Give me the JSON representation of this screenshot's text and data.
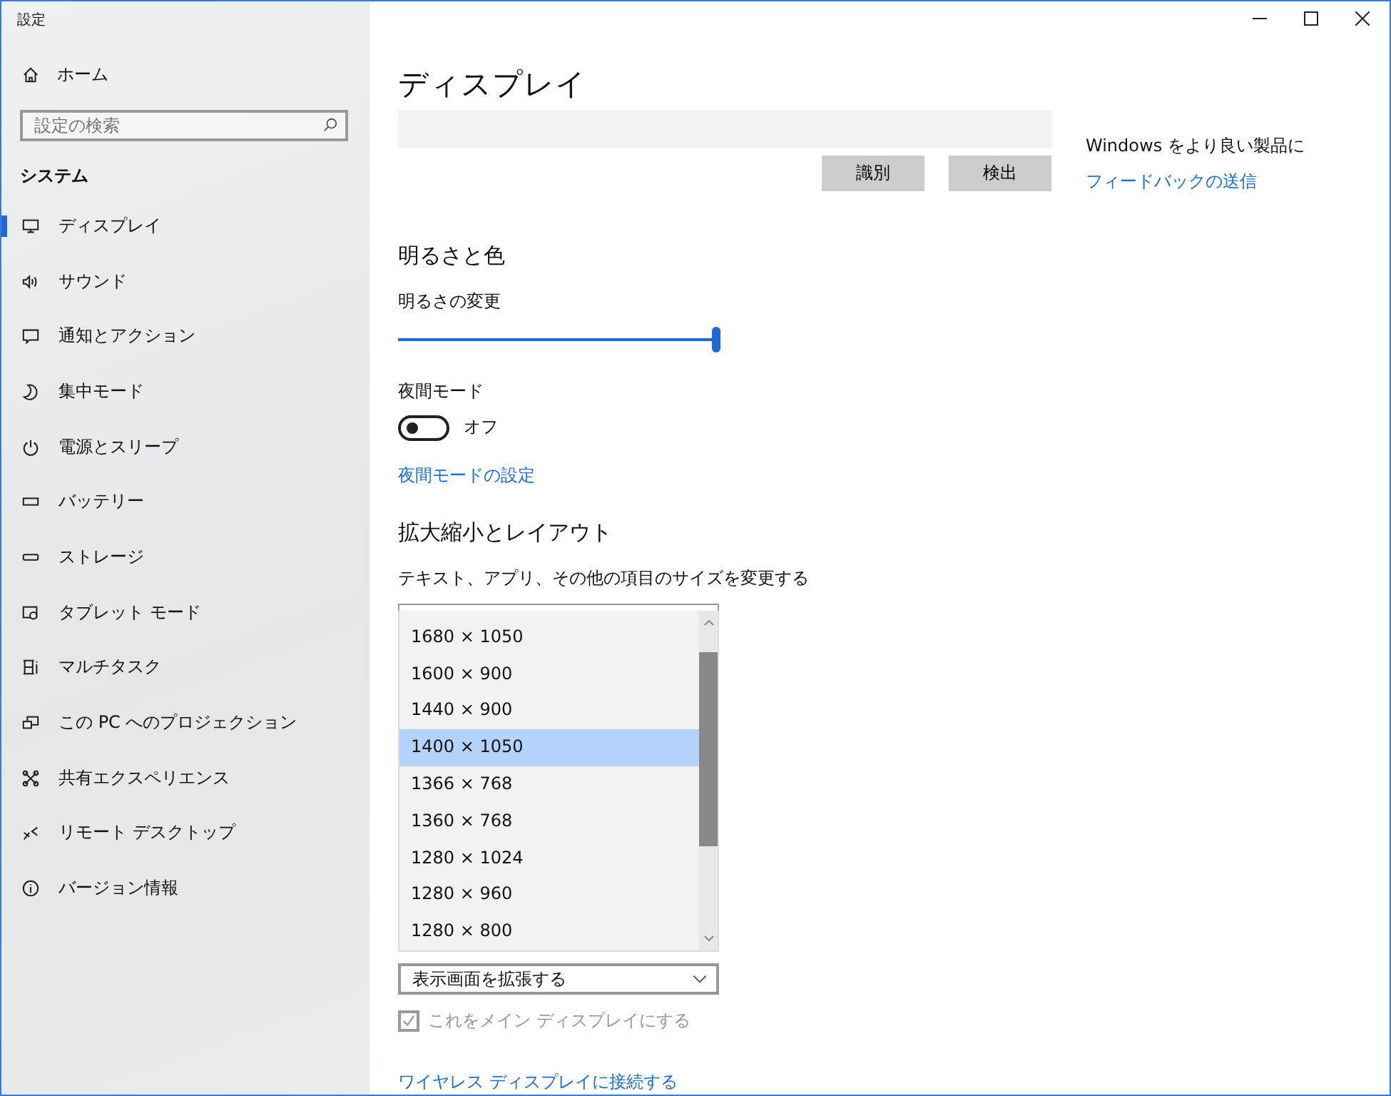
{
  "window": {
    "title": "設定"
  },
  "sidebar": {
    "home": {
      "label": "ホーム"
    },
    "search": {
      "placeholder": "設定の検索"
    },
    "section": "システム",
    "items": [
      {
        "label": "ディスプレイ",
        "kind": "display",
        "selected": true
      },
      {
        "label": "サウンド",
        "kind": "sound",
        "selected": false
      },
      {
        "label": "通知とアクション",
        "kind": "notify",
        "selected": false
      },
      {
        "label": "集中モード",
        "kind": "moon",
        "selected": false
      },
      {
        "label": "電源とスリープ",
        "kind": "power",
        "selected": false
      },
      {
        "label": "バッテリー",
        "kind": "battery",
        "selected": false
      },
      {
        "label": "ストレージ",
        "kind": "storage",
        "selected": false
      },
      {
        "label": "タブレット モード",
        "kind": "tablet",
        "selected": false
      },
      {
        "label": "マルチタスク",
        "kind": "multitask",
        "selected": false
      },
      {
        "label": "この PC へのプロジェクション",
        "kind": "project",
        "selected": false
      },
      {
        "label": "共有エクスペリエンス",
        "kind": "share",
        "selected": false
      },
      {
        "label": "リモート デスクトップ",
        "kind": "remote",
        "selected": false
      },
      {
        "label": "バージョン情報",
        "kind": "info",
        "selected": false
      }
    ]
  },
  "main": {
    "title": "ディスプレイ",
    "buttons": [
      "識別",
      "検出"
    ],
    "feedback": {
      "text": "Windows をより良い製品に",
      "link": "フィードバックの送信"
    },
    "brightness": {
      "heading": "明るさと色",
      "label": "明るさの変更",
      "level": 1.0
    },
    "night_light": {
      "label": "夜間モード",
      "on": false,
      "state_label": "オフ",
      "link": "夜間モードの設定"
    },
    "scale": {
      "heading": "拡大縮小とレイアウト",
      "label": "テキスト、アプリ、その他の項目のサイズを変更する",
      "options": [
        {
          "label": "1680 × 1050",
          "selected": false
        },
        {
          "label": "1600 × 900",
          "selected": false
        },
        {
          "label": "1440 × 900",
          "selected": false
        },
        {
          "label": "1400 × 1050",
          "selected": true
        },
        {
          "label": "1366 × 768",
          "selected": false
        },
        {
          "label": "1360 × 768",
          "selected": false
        },
        {
          "label": "1280 × 1024",
          "selected": false
        },
        {
          "label": "1280 × 960",
          "selected": false
        },
        {
          "label": "1280 × 800",
          "selected": false
        }
      ]
    },
    "multiple_displays": {
      "value": "表示画面を拡張する"
    },
    "main_display": {
      "label": "これをメイン ディスプレイにする",
      "checked": true,
      "disabled": true
    },
    "wireless_link": "ワイヤレス ディスプレイに接続する"
  }
}
